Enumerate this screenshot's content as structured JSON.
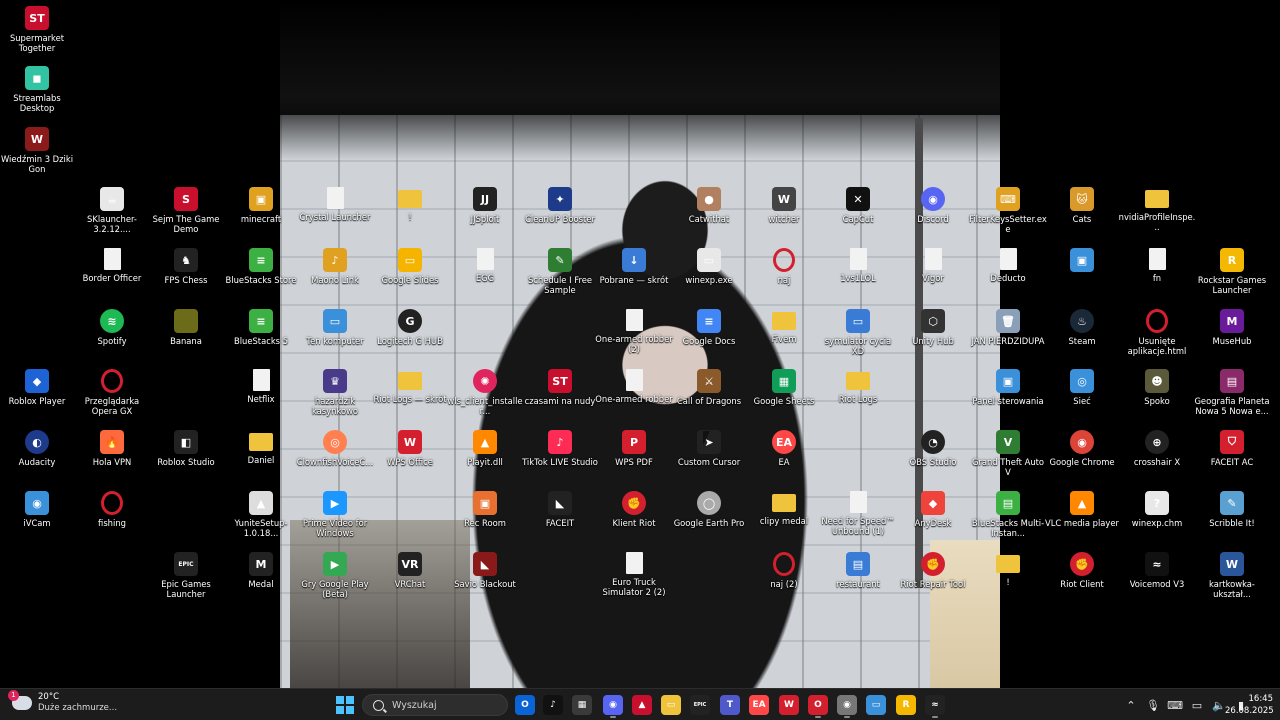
{
  "desktop": {
    "icons": [
      {
        "label": "Supermarket Together",
        "icon": "supermarket-together-icon",
        "color": "#c8102e",
        "glyph": "ST",
        "kind": "app"
      },
      {
        "label": "Streamlabs Desktop",
        "icon": "streamlabs-icon",
        "color": "#31c3a2",
        "glyph": "◼",
        "kind": "app"
      },
      {
        "label": "Wiedźmin 3 Dziki Gon",
        "icon": "witcher-icon",
        "color": "#8b1a1a",
        "glyph": "W",
        "kind": "app"
      },
      {
        "label": "SKlauncher-3.2.12....",
        "icon": "java-icon",
        "color": "#e8e8e8",
        "glyph": "☕",
        "kind": "app"
      },
      {
        "label": "Sejm The Game Demo",
        "icon": "sejm-game-icon",
        "color": "#c8102e",
        "glyph": "S",
        "kind": "app"
      },
      {
        "label": "minecraft",
        "icon": "minecraft-icon",
        "color": "#e0a020",
        "glyph": "▣",
        "kind": "app"
      },
      {
        "label": "Crystal Launcher",
        "icon": "file-icon",
        "color": "#f2f2f2",
        "glyph": "",
        "kind": "page"
      },
      {
        "label": "!",
        "icon": "folder-icon",
        "color": "#f0c33c",
        "glyph": "",
        "kind": "folder"
      },
      {
        "label": "JJSploit",
        "icon": "jjsploit-icon",
        "color": "#222",
        "glyph": "JJ",
        "kind": "app"
      },
      {
        "label": "CleanUP Booster",
        "icon": "cleanup-icon",
        "color": "#1e3a8a",
        "glyph": "✦",
        "kind": "app"
      },
      {
        "label": "Catwithat",
        "icon": "catwithat-icon",
        "color": "#b08060",
        "glyph": "●",
        "kind": "app"
      },
      {
        "label": "witcher",
        "icon": "witcher-wolf-icon",
        "color": "#444",
        "glyph": "W",
        "kind": "app"
      },
      {
        "label": "CapCut",
        "icon": "capcut-icon",
        "color": "#111",
        "glyph": "✕",
        "kind": "app"
      },
      {
        "label": "Discord",
        "icon": "discord-icon",
        "color": "#5865f2",
        "glyph": "◉",
        "kind": "round"
      },
      {
        "label": "FilterKeysSetter.exe",
        "icon": "filterkeys-icon",
        "color": "#e0a020",
        "glyph": "⌨",
        "kind": "app"
      },
      {
        "label": "Cats",
        "icon": "cats-icon",
        "color": "#d99a2b",
        "glyph": "🐱",
        "kind": "app"
      },
      {
        "label": "nvidiaProfileInspe...",
        "icon": "folder-icon",
        "color": "#f0c33c",
        "glyph": "",
        "kind": "folder"
      },
      {
        "label": "Border Officer",
        "icon": "file-icon",
        "color": "#f2f2f2",
        "glyph": "",
        "kind": "page"
      },
      {
        "label": "FPS Chess",
        "icon": "fps-chess-icon",
        "color": "#222",
        "glyph": "♞",
        "kind": "app"
      },
      {
        "label": "BlueStacks Store",
        "icon": "bluestacks-icon",
        "color": "#3cb043",
        "glyph": "≡",
        "kind": "app"
      },
      {
        "label": "Maono Link",
        "icon": "maono-icon",
        "color": "#e0a020",
        "glyph": "♪",
        "kind": "app"
      },
      {
        "label": "Google Slides",
        "icon": "google-slides-icon",
        "color": "#f4b400",
        "glyph": "▭",
        "kind": "app"
      },
      {
        "label": "EGG",
        "icon": "file-icon",
        "color": "#f2f2f2",
        "glyph": "",
        "kind": "page"
      },
      {
        "label": "Schedule I Free Sample",
        "icon": "schedule-icon",
        "color": "#2e7d32",
        "glyph": "✎",
        "kind": "app"
      },
      {
        "label": "Pobrane — skrót",
        "icon": "downloads-icon",
        "color": "#3a7bd5",
        "glyph": "↓",
        "kind": "app"
      },
      {
        "label": "winexp.exe",
        "icon": "window-icon",
        "color": "#e8e8e8",
        "glyph": "▭",
        "kind": "app"
      },
      {
        "label": "naj",
        "icon": "opera-icon",
        "color": "#d4202e",
        "glyph": "",
        "kind": "ring"
      },
      {
        "label": "1vs1LOL",
        "icon": "file-icon",
        "color": "#f2f2f2",
        "glyph": "",
        "kind": "page"
      },
      {
        "label": "Vigor",
        "icon": "file-icon",
        "color": "#f2f2f2",
        "glyph": "",
        "kind": "page"
      },
      {
        "label": "Deducto",
        "icon": "file-icon",
        "color": "#f2f2f2",
        "glyph": "",
        "kind": "page"
      },
      {
        "label": "",
        "icon": "monitor-icon",
        "color": "#3a90d9",
        "glyph": "▣",
        "kind": "app"
      },
      {
        "label": "fn",
        "icon": "file-icon",
        "color": "#f2f2f2",
        "glyph": "",
        "kind": "page"
      },
      {
        "label": "Rockstar Games Launcher",
        "icon": "rockstar-icon",
        "color": "#f5b800",
        "glyph": "R",
        "kind": "app"
      },
      {
        "label": "Spotify",
        "icon": "spotify-icon",
        "color": "#1db954",
        "glyph": "≋",
        "kind": "round"
      },
      {
        "label": "Banana",
        "icon": "banana-icon",
        "color": "#6b6b1a",
        "glyph": "",
        "kind": "app"
      },
      {
        "label": "BlueStacks 5",
        "icon": "bluestacks-icon",
        "color": "#3cb043",
        "glyph": "≡",
        "kind": "app"
      },
      {
        "label": "Ten komputer",
        "icon": "computer-icon",
        "color": "#3a90d9",
        "glyph": "▭",
        "kind": "app"
      },
      {
        "label": "Logitech G HUB",
        "icon": "logitech-icon",
        "color": "#222",
        "glyph": "G",
        "kind": "round"
      },
      {
        "label": "One-armed robber (2)",
        "icon": "file-icon",
        "color": "#f2f2f2",
        "glyph": "",
        "kind": "page"
      },
      {
        "label": "Google Docs",
        "icon": "google-docs-icon",
        "color": "#4285f4",
        "glyph": "≡",
        "kind": "app"
      },
      {
        "label": "Fivem",
        "icon": "folder-icon",
        "color": "#f0c33c",
        "glyph": "",
        "kind": "folder"
      },
      {
        "label": "symulator cycia XD",
        "icon": "file-icon",
        "color": "#3a7bd5",
        "glyph": "▭",
        "kind": "app"
      },
      {
        "label": "Unity Hub",
        "icon": "unity-icon",
        "color": "#333",
        "glyph": "⬡",
        "kind": "app"
      },
      {
        "label": "JAN PIERDZIDUPA",
        "icon": "recycle-bin-icon",
        "color": "#8aa0b8",
        "glyph": "🗑",
        "kind": "app"
      },
      {
        "label": "Steam",
        "icon": "steam-icon",
        "color": "#1b2838",
        "glyph": "♨",
        "kind": "round"
      },
      {
        "label": "Usunięte aplikacje.html",
        "icon": "opera-icon",
        "color": "#d4202e",
        "glyph": "",
        "kind": "ring"
      },
      {
        "label": "MuseHub",
        "icon": "musehub-icon",
        "color": "#6a1b9a",
        "glyph": "M",
        "kind": "app"
      },
      {
        "label": "Roblox Player",
        "icon": "roblox-icon",
        "color": "#1e63d6",
        "glyph": "◆",
        "kind": "app"
      },
      {
        "label": "Przeglądarka Opera GX",
        "icon": "opera-gx-icon",
        "color": "#d4202e",
        "glyph": "",
        "kind": "ring"
      },
      {
        "label": "Netflix",
        "icon": "file-icon",
        "color": "#f2f2f2",
        "glyph": "",
        "kind": "page"
      },
      {
        "label": "hazardzik kasynkowo",
        "icon": "casino-icon",
        "color": "#4a3a8a",
        "glyph": "♛",
        "kind": "app"
      },
      {
        "label": "Riot Logs — skrót",
        "icon": "folder-icon",
        "color": "#f0c33c",
        "glyph": "",
        "kind": "folder"
      },
      {
        "label": "wls_client_installer...",
        "icon": "installer-icon",
        "color": "#e0245e",
        "glyph": "✺",
        "kind": "round"
      },
      {
        "label": "czasami na nudy",
        "icon": "sejm-game-icon",
        "color": "#c8102e",
        "glyph": "ST",
        "kind": "app"
      },
      {
        "label": "One-armed robber",
        "icon": "file-icon",
        "color": "#f2f2f2",
        "glyph": "",
        "kind": "page"
      },
      {
        "label": "Call of Dragons",
        "icon": "call-of-dragons-icon",
        "color": "#8b5a2b",
        "glyph": "⚔",
        "kind": "app"
      },
      {
        "label": "Google Sheets",
        "icon": "google-sheets-icon",
        "color": "#0f9d58",
        "glyph": "▦",
        "kind": "app"
      },
      {
        "label": "Riot Logs",
        "icon": "folder-icon",
        "color": "#f0c33c",
        "glyph": "",
        "kind": "folder"
      },
      {
        "label": "Panel sterowania",
        "icon": "control-panel-icon",
        "color": "#3a90d9",
        "glyph": "▣",
        "kind": "app"
      },
      {
        "label": "Sieć",
        "icon": "network-icon",
        "color": "#3a90d9",
        "glyph": "◎",
        "kind": "app"
      },
      {
        "label": "Spoko",
        "icon": "spoko-icon",
        "color": "#5a5a3a",
        "glyph": "☻",
        "kind": "app"
      },
      {
        "label": "Geografia Planeta Nowa 5 Nowa e...",
        "icon": "winrar-icon",
        "color": "#8b2a6a",
        "glyph": "▤",
        "kind": "app"
      },
      {
        "label": "Audacity",
        "icon": "audacity-icon",
        "color": "#1e3a8a",
        "glyph": "◐",
        "kind": "round"
      },
      {
        "label": "Hola VPN",
        "icon": "hola-vpn-icon",
        "color": "#ff6a3d",
        "glyph": "🔥",
        "kind": "app"
      },
      {
        "label": "Roblox Studio",
        "icon": "roblox-studio-icon",
        "color": "#222",
        "glyph": "◧",
        "kind": "app"
      },
      {
        "label": "Daniel",
        "icon": "folder-icon",
        "color": "#f0c33c",
        "glyph": "",
        "kind": "folder"
      },
      {
        "label": "ClownfishVoiceC...",
        "icon": "clownfish-icon",
        "color": "#ff7f50",
        "glyph": "◎",
        "kind": "round"
      },
      {
        "label": "WPS Office",
        "icon": "wps-office-icon",
        "color": "#d4202e",
        "glyph": "W",
        "kind": "app"
      },
      {
        "label": "Playit.dll",
        "icon": "vlc-icon",
        "color": "#ff8800",
        "glyph": "▲",
        "kind": "app"
      },
      {
        "label": "TikTok LIVE Studio",
        "icon": "tiktok-live-icon",
        "color": "#fe2c55",
        "glyph": "♪",
        "kind": "app"
      },
      {
        "label": "WPS PDF",
        "icon": "wps-pdf-icon",
        "color": "#d4202e",
        "glyph": "P",
        "kind": "app"
      },
      {
        "label": "Custom Cursor",
        "icon": "custom-cursor-icon",
        "color": "#222",
        "glyph": "➤",
        "kind": "app"
      },
      {
        "label": "EA",
        "icon": "ea-icon",
        "color": "#ff4747",
        "glyph": "EA",
        "kind": "round"
      },
      {
        "label": "OBS Studio",
        "icon": "obs-icon",
        "color": "#222",
        "glyph": "◔",
        "kind": "round"
      },
      {
        "label": "Grand Theft Auto V",
        "icon": "gta-icon",
        "color": "#2e7d32",
        "glyph": "V",
        "kind": "app"
      },
      {
        "label": "Google Chrome",
        "icon": "chrome-icon",
        "color": "#db4437",
        "glyph": "◉",
        "kind": "round"
      },
      {
        "label": "crosshair X",
        "icon": "crosshair-icon",
        "color": "#222",
        "glyph": "⊕",
        "kind": "round"
      },
      {
        "label": "FACEIT AC",
        "icon": "faceit-ac-icon",
        "color": "#d4202e",
        "glyph": "⛉",
        "kind": "app"
      },
      {
        "label": "iVCam",
        "icon": "ivcam-icon",
        "color": "#3a90d9",
        "glyph": "◉",
        "kind": "app"
      },
      {
        "label": "fishing",
        "icon": "opera-icon",
        "color": "#d4202e",
        "glyph": "",
        "kind": "ring"
      },
      {
        "label": "YuniteSetup-1.0.18...",
        "icon": "yunite-icon",
        "color": "#ddd",
        "glyph": "▲",
        "kind": "app"
      },
      {
        "label": "Prime Video for Windows",
        "icon": "prime-video-icon",
        "color": "#1a98ff",
        "glyph": "▶",
        "kind": "app"
      },
      {
        "label": "Rec Room",
        "icon": "rec-room-icon",
        "color": "#e87030",
        "glyph": "▣",
        "kind": "app"
      },
      {
        "label": "FACEIT",
        "icon": "faceit-icon",
        "color": "#222",
        "glyph": "◣",
        "kind": "app"
      },
      {
        "label": "Klient Riot",
        "icon": "riot-client-icon",
        "color": "#d4202e",
        "glyph": "✊",
        "kind": "round"
      },
      {
        "label": "Google Earth Pro",
        "icon": "google-earth-icon",
        "color": "#aaa",
        "glyph": "◯",
        "kind": "round"
      },
      {
        "label": "clipy medal",
        "icon": "folder-icon",
        "color": "#f0c33c",
        "glyph": "",
        "kind": "folder"
      },
      {
        "label": "Need for Speed™ Unbound (1)",
        "icon": "file-icon",
        "color": "#f2f2f2",
        "glyph": "",
        "kind": "page"
      },
      {
        "label": "AnyDesk",
        "icon": "anydesk-icon",
        "color": "#ef443b",
        "glyph": "◆",
        "kind": "app"
      },
      {
        "label": "BlueStacks Multi-Instan...",
        "icon": "bluestacks-multi-icon",
        "color": "#3cb043",
        "glyph": "▤",
        "kind": "app"
      },
      {
        "label": "VLC media player",
        "icon": "vlc-icon",
        "color": "#ff8800",
        "glyph": "▲",
        "kind": "app"
      },
      {
        "label": "winexp.chm",
        "icon": "help-file-icon",
        "color": "#e8e8e8",
        "glyph": "?",
        "kind": "app"
      },
      {
        "label": "Scribble It!",
        "icon": "scribble-icon",
        "color": "#5aa0d0",
        "glyph": "✎",
        "kind": "app"
      },
      {
        "label": "Epic Games Launcher",
        "icon": "epic-games-icon",
        "color": "#222",
        "glyph": "EPIC",
        "kind": "app"
      },
      {
        "label": "Medal",
        "icon": "medal-icon",
        "color": "#222",
        "glyph": "M",
        "kind": "app"
      },
      {
        "label": "Gry Google Play (Beta)",
        "icon": "google-play-games-icon",
        "color": "#34a853",
        "glyph": "▶",
        "kind": "app"
      },
      {
        "label": "VRChat",
        "icon": "vrchat-icon",
        "color": "#222",
        "glyph": "VR",
        "kind": "app"
      },
      {
        "label": "Savio Blackout",
        "icon": "savio-icon",
        "color": "#8a1a1a",
        "glyph": "◣",
        "kind": "app"
      },
      {
        "label": "Euro Truck Simulator 2 (2)",
        "icon": "file-icon",
        "color": "#f2f2f2",
        "glyph": "",
        "kind": "page"
      },
      {
        "label": "naj (2)",
        "icon": "opera-icon",
        "color": "#d4202e",
        "glyph": "",
        "kind": "ring"
      },
      {
        "label": "restaurant",
        "icon": "restaurant-icon",
        "color": "#3a7bd5",
        "glyph": "▤",
        "kind": "app"
      },
      {
        "label": "Riot Repair Tool",
        "icon": "riot-repair-icon",
        "color": "#d4202e",
        "glyph": "✊",
        "kind": "round"
      },
      {
        "label": "!",
        "icon": "folder-icon",
        "color": "#f0c33c",
        "glyph": "",
        "kind": "folder"
      },
      {
        "label": "Riot Client",
        "icon": "riot-client-icon",
        "color": "#d4202e",
        "glyph": "✊",
        "kind": "round"
      },
      {
        "label": "Voicemod V3",
        "icon": "voicemod-icon",
        "color": "#111",
        "glyph": "≈",
        "kind": "app"
      },
      {
        "label": "kartkowka-ukształ...",
        "icon": "word-icon",
        "color": "#2b579a",
        "glyph": "W",
        "kind": "app"
      }
    ]
  },
  "taskbar": {
    "weather": {
      "temp": "20°C",
      "desc": "Duże zachmurze...",
      "badge": "1",
      "icon": "weather-cloud-icon"
    },
    "search": {
      "placeholder": "Wyszukaj"
    },
    "apps": [
      {
        "name": "outlook-icon",
        "color": "#0a64d6",
        "glyph": "O"
      },
      {
        "name": "tiktok-icon",
        "color": "#111",
        "glyph": "♪"
      },
      {
        "name": "microsoft-store-icon",
        "color": "#3a3a3a",
        "glyph": "▦"
      },
      {
        "name": "discord-icon",
        "color": "#5865f2",
        "glyph": "◉"
      },
      {
        "name": "pdf-icon",
        "color": "#c8102e",
        "glyph": "▲"
      },
      {
        "name": "file-explorer-icon",
        "color": "#f0c33c",
        "glyph": "▭"
      },
      {
        "name": "epic-games-icon",
        "color": "#222",
        "glyph": "EPIC"
      },
      {
        "name": "teams-icon",
        "color": "#5059c9",
        "glyph": "T"
      },
      {
        "name": "ea-icon",
        "color": "#ff4747",
        "glyph": "EA"
      },
      {
        "name": "wps-office-icon",
        "color": "#d4202e",
        "glyph": "W"
      },
      {
        "name": "opera-gx-icon",
        "color": "#d4202e",
        "glyph": "O"
      },
      {
        "name": "chrome-icon",
        "color": "#777",
        "glyph": "◉"
      },
      {
        "name": "remote-desktop-icon",
        "color": "#3a90d9",
        "glyph": "▭"
      },
      {
        "name": "rockstar-icon",
        "color": "#f5b800",
        "glyph": "R"
      },
      {
        "name": "voicemod-icon",
        "color": "#222",
        "glyph": "≈"
      }
    ],
    "clock": {
      "time": "16:45",
      "date": "26.08.2025"
    }
  },
  "colors": {
    "taskbar_bg": "#1c1c1c",
    "accent": "#4cc2ff"
  }
}
